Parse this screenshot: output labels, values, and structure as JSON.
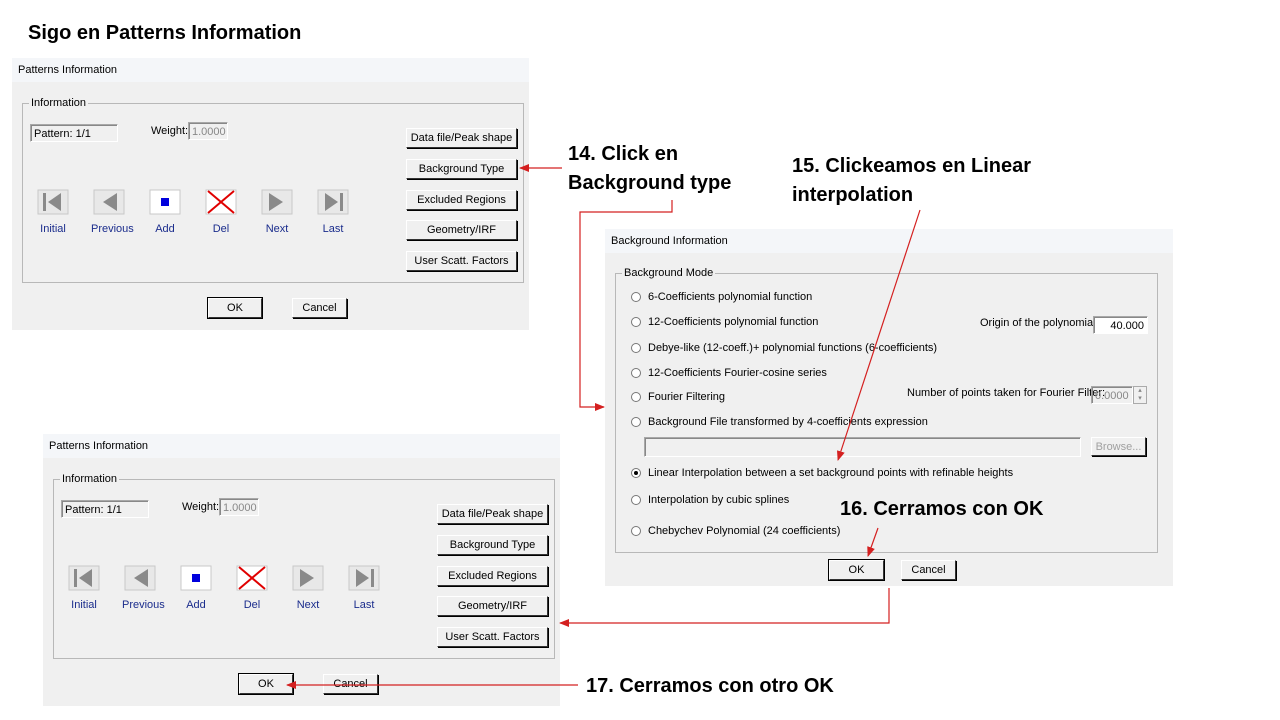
{
  "slide_title": "Sigo en Patterns Information",
  "notes": {
    "step14": "14. Click en\nBackground type",
    "step15": "15. Clickeamos en Linear\ninterpolation",
    "step16": "16. Cerramos con OK",
    "step17": "17. Cerramos con otro OK"
  },
  "patterns_top": {
    "title": "Patterns Information",
    "group_label": "Information",
    "pattern_text": "Pattern: 1/1",
    "weight_label": "Weight:",
    "weight_value": "1.0000",
    "side_buttons": [
      "Data file/Peak shape",
      "Background Type",
      "Excluded Regions",
      "Geometry/IRF",
      "User Scatt. Factors"
    ],
    "nav": [
      "Initial",
      "Previous",
      "Add",
      "Del",
      "Next",
      "Last"
    ],
    "ok": "OK",
    "cancel": "Cancel"
  },
  "background": {
    "title": "Background Information",
    "group_label": "Background Mode",
    "options": [
      "6-Coefficients polynomial function",
      "12-Coefficients polynomial function",
      "Debye-like (12-coeff.)+ polynomial functions (6-coefficients)",
      "12-Coefficients Fourier-cosine series",
      "Fourier Filtering",
      "Background File transformed by 4-coefficients expression",
      "Linear Interpolation between a set background points with refinable heights",
      "Interpolation by cubic splines",
      "Chebychev Polynomial (24 coefficients)"
    ],
    "selected": "Linear Interpolation between a set background points with refinable heights",
    "origin_label": "Origin of the polynomial:",
    "origin_value": "40.000",
    "fourier_label": "Number of points taken for Fourier Filter:",
    "fourier_value": "0.0000",
    "browse": "Browse...",
    "ok": "OK",
    "cancel": "Cancel"
  },
  "patterns_bottom": {
    "title": "Patterns Information",
    "group_label": "Information",
    "pattern_text": "Pattern: 1/1",
    "weight_label": "Weight:",
    "weight_value": "1.0000",
    "side_buttons": [
      "Data file/Peak shape",
      "Background Type",
      "Excluded Regions",
      "Geometry/IRF",
      "User Scatt. Factors"
    ],
    "nav": [
      "Initial",
      "Previous",
      "Add",
      "Del",
      "Next",
      "Last"
    ],
    "ok": "OK",
    "cancel": "Cancel"
  },
  "colors": {
    "arrow": "#d42020",
    "nav_caption": "#1a2c8c",
    "add_icon": "#0000dd",
    "del_icon": "#e00000"
  }
}
